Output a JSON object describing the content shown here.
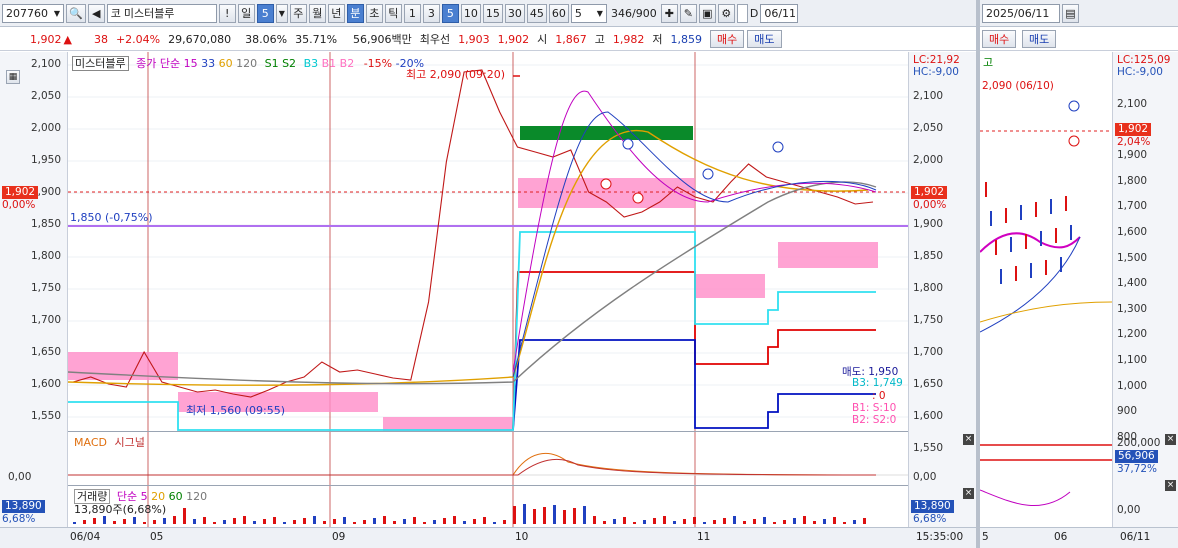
{
  "toolbar": {
    "code": "207760",
    "market_badge": "코",
    "name": "미스터블루",
    "bang": "!",
    "period_day": "일",
    "period_count": "5",
    "period_week": "주",
    "period_month": "월",
    "period_year": "년",
    "period_minute": "분",
    "period_second": "초",
    "period_tick": "틱",
    "intervals": [
      "1",
      "3",
      "5",
      "10",
      "15",
      "30",
      "45",
      "60"
    ],
    "active_interval": "5",
    "step": "5",
    "bars_display": "346/900",
    "d_label": "D",
    "date": "06/11"
  },
  "quote": {
    "price": "1,902",
    "change": "38",
    "change_pct": "+2.04%",
    "volume": "29,670,080",
    "turnover_ratio": "38.06%",
    "strength": "35.71%",
    "amount": "56,906백만",
    "best_label": "최우선",
    "best_ask": "1,903",
    "best_bid": "1,902",
    "open_label": "시",
    "open": "1,867",
    "high_label": "고",
    "high": "1,982",
    "low_label": "저",
    "low": "1,859",
    "buy_label": "매수",
    "sell_label": "매도"
  },
  "main": {
    "legend_name": "미스터블루",
    "legend_ma": "종가 단순",
    "ma_periods": [
      "15",
      "33",
      "60",
      "120"
    ],
    "levels": [
      "S1",
      "S2",
      "B3",
      "B1",
      "B2"
    ],
    "pct_lines": [
      "-15%",
      "-20%"
    ],
    "lc_label": "LC:21,92",
    "hc_label": "HC:-9,00",
    "high_note": "최고 2,090 (09:20)",
    "low_note": "최저 1,560 (09:55)",
    "ref_line": "1,850 (-0,75%)",
    "price_tag": "1,902",
    "price_tag_pct": "0,00%",
    "sig_sell": "매도: 1,950",
    "sig_b3": "B3: 1,749",
    "sig_zero": ": 0",
    "sig_b1": "B1: S:10",
    "sig_b2": "B2: S2:0",
    "signal_s": "S",
    "signal_b": "B",
    "y_labels": [
      "2,100",
      "2,050",
      "2,000",
      "1,950",
      "1,900",
      "1,850",
      "1,800",
      "1,750",
      "1,700",
      "1,650",
      "1,600",
      "1,550"
    ]
  },
  "macd": {
    "label": "MACD",
    "signal": "시그널",
    "zero": "0,00"
  },
  "volume": {
    "label": "거래량",
    "ma": "단순",
    "periods": [
      "5",
      "20",
      "60",
      "120"
    ],
    "current": "13,890주(6,68%)",
    "tag": "13,890",
    "tag_pct": "6,68%"
  },
  "xaxis": {
    "labels": [
      "06/04",
      "05",
      "09",
      "10",
      "11"
    ],
    "time": "15:35:00"
  },
  "right_window": {
    "date": "2025/06/11",
    "buy_label": "매수",
    "sell_label": "매도",
    "high_label": "고",
    "high_note": "2,090 (06/10)",
    "lc_label": "LC:125,09",
    "hc_label": "HC:-9,00",
    "price_tag": "1,902",
    "pct": "2,04%",
    "signal_s": "S",
    "signal_b": "B",
    "y_labels": [
      "2,100",
      "2,000",
      "1,900",
      "1,800",
      "1,700",
      "1,600",
      "1,500",
      "1,400",
      "1,300",
      "1,200",
      "1,100",
      "1,000",
      "900",
      "800"
    ],
    "vol_top": "200,000",
    "vol_tag": "56,906",
    "vol_pct": "37,72%",
    "macd_zero": "0,00",
    "x_labels": [
      "5",
      "06",
      "06/11"
    ]
  }
}
